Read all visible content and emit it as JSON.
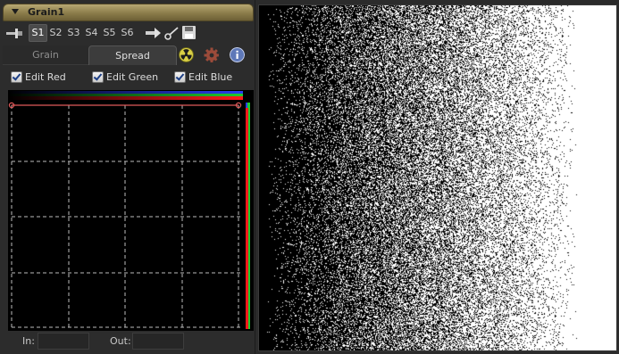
{
  "header": {
    "title": "Grain1"
  },
  "toolbar": {
    "slots": [
      "S1",
      "S2",
      "S3",
      "S4",
      "S5",
      "S6"
    ],
    "active_slot": "S1"
  },
  "tabs": [
    {
      "label": "Grain",
      "active": false
    },
    {
      "label": "Spread",
      "active": true
    }
  ],
  "icons": {
    "pin": "pin-icon",
    "right_arrow": "right-arrow-icon",
    "link": "link-icon",
    "save": "save-icon",
    "radiation": "radiation-icon",
    "gear": "gear-icon",
    "info": "info-icon"
  },
  "checkboxes": [
    {
      "label": "Edit Red",
      "checked": true
    },
    {
      "label": "Edit Green",
      "checked": true
    },
    {
      "label": "Edit Blue",
      "checked": true
    }
  ],
  "io": {
    "in_label": "In:",
    "out_label": "Out:",
    "in_value": "",
    "out_value": ""
  },
  "colors": {
    "header_gold": "#9a8b58",
    "curve": "#e05a5a",
    "red_channel": "#ff1b1b",
    "green_channel": "#1ecc2e",
    "blue_channel": "#2a3df0"
  }
}
